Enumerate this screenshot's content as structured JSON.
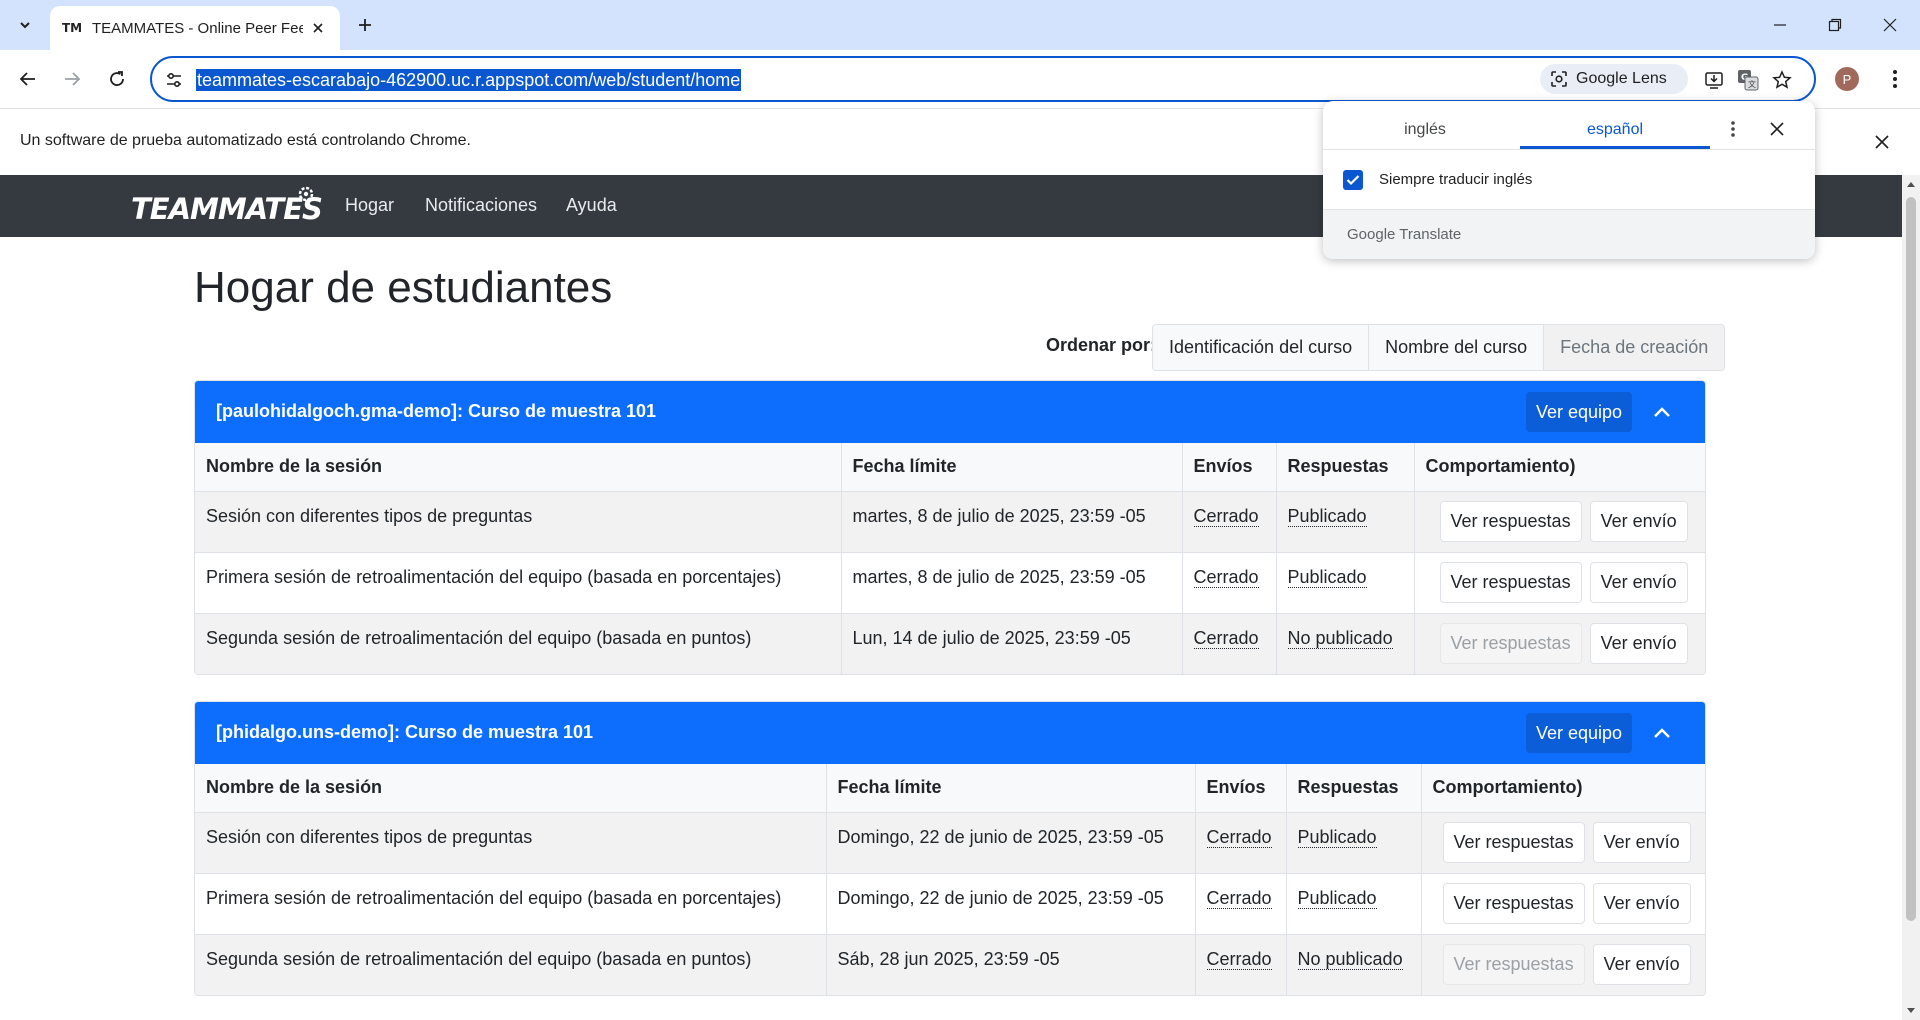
{
  "browser": {
    "tab_title": "TEAMMATES - Online Peer Feed",
    "tab_favicon": "TM",
    "url": "teammates-escarabajo-462900.uc.r.appspot.com/web/student/home",
    "lens_label": "Google Lens",
    "profile_initial": "P",
    "infobar_text": "Un software de prueba automatizado está controlando Chrome."
  },
  "translate_popup": {
    "source_lang": "inglés",
    "target_lang": "español",
    "always_translate_label": "Siempre traducir inglés",
    "always_translate_checked": true,
    "brand_google": "Google",
    "brand_translate": "Translate"
  },
  "app": {
    "brand": "TEAMMATES",
    "nav": [
      "Hogar",
      "Notificaciones",
      "Ayuda"
    ],
    "page_title": "Hogar de estudiantes",
    "sort_label": "Ordenar por:",
    "sort_options": [
      "Identificación del curso",
      "Nombre del curso",
      "Fecha de creación"
    ],
    "active_sort": "Fecha de creación"
  },
  "courses": [
    {
      "title": "[paulohidalgoch.gma-demo]: Curso de muestra 101",
      "team_button": "Ver equipo",
      "headers": [
        "Nombre de la sesión",
        "Fecha límite",
        "Envíos",
        "Respuestas",
        "Comportamiento)"
      ],
      "rows": [
        {
          "name": "Sesión con diferentes tipos de preguntas",
          "deadline": "martes, 8 de julio de 2025, 23:59 -05",
          "submissions": "Cerrado",
          "responses": "Publicado",
          "view_responses": "Ver respuestas",
          "view_responses_enabled": true,
          "view_submission": "Ver envío"
        },
        {
          "name": "Primera sesión de retroalimentación del equipo (basada en porcentajes)",
          "deadline": "martes, 8 de julio de 2025, 23:59 -05",
          "submissions": "Cerrado",
          "responses": "Publicado",
          "view_responses": "Ver respuestas",
          "view_responses_enabled": true,
          "view_submission": "Ver envío"
        },
        {
          "name": "Segunda sesión de retroalimentación del equipo (basada en puntos)",
          "deadline": "Lun, 14 de julio de 2025, 23:59 -05",
          "submissions": "Cerrado",
          "responses": "No publicado",
          "view_responses": "Ver respuestas",
          "view_responses_enabled": false,
          "view_submission": "Ver envío"
        }
      ]
    },
    {
      "title": "[phidalgo.uns-demo]: Curso de muestra 101",
      "team_button": "Ver equipo",
      "headers": [
        "Nombre de la sesión",
        "Fecha límite",
        "Envíos",
        "Respuestas",
        "Comportamiento)"
      ],
      "rows": [
        {
          "name": "Sesión con diferentes tipos de preguntas",
          "deadline": "Domingo, 22 de junio de 2025, 23:59 -05",
          "submissions": "Cerrado",
          "responses": "Publicado",
          "view_responses": "Ver respuestas",
          "view_responses_enabled": true,
          "view_submission": "Ver envío"
        },
        {
          "name": "Primera sesión de retroalimentación del equipo (basada en porcentajes)",
          "deadline": "Domingo, 22 de junio de 2025, 23:59 -05",
          "submissions": "Cerrado",
          "responses": "Publicado",
          "view_responses": "Ver respuestas",
          "view_responses_enabled": true,
          "view_submission": "Ver envío"
        },
        {
          "name": "Segunda sesión de retroalimentación del equipo (basada en puntos)",
          "deadline": "Sáb, 28 jun 2025, 23:59 -05",
          "submissions": "Cerrado",
          "responses": "No publicado",
          "view_responses": "Ver respuestas",
          "view_responses_enabled": false,
          "view_submission": "Ver envío"
        }
      ]
    }
  ],
  "colors": {
    "card_header": "#0d6efd",
    "navbar": "#343a40",
    "chrome_accent": "#0b57d0",
    "tabstrip": "#d3e3fd"
  }
}
